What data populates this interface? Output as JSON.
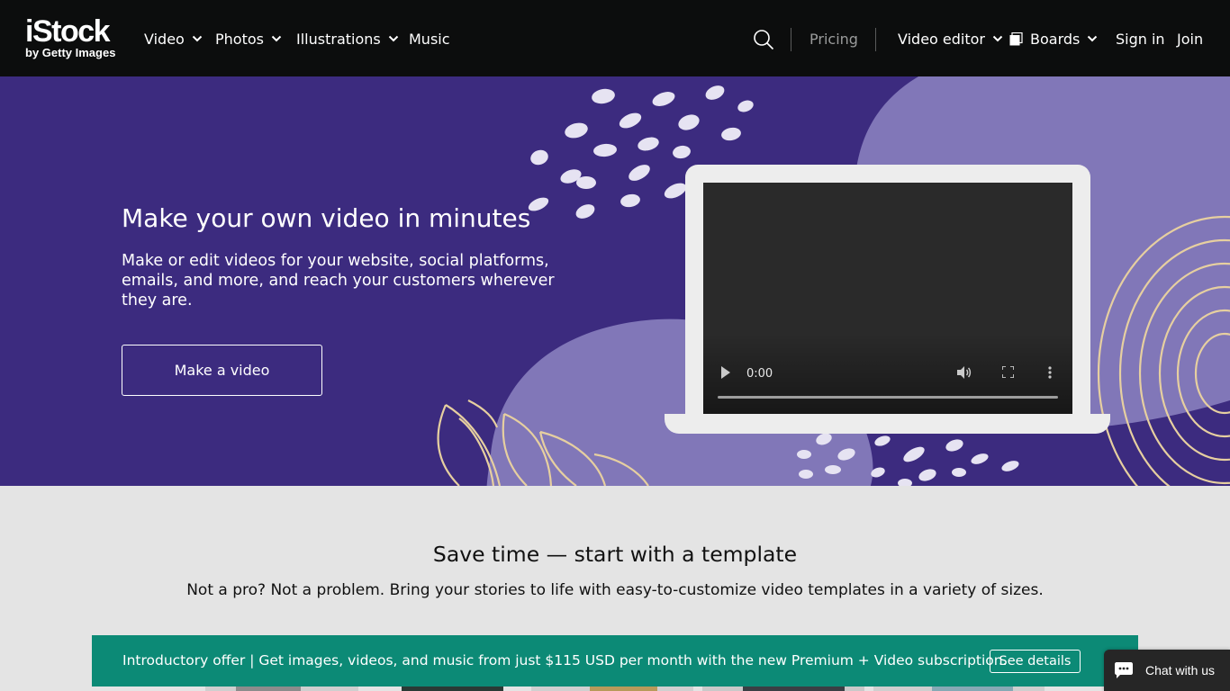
{
  "header": {
    "logo_main": "iStock",
    "logo_sub": "by Getty Images",
    "nav": {
      "video": "Video",
      "photos": "Photos",
      "illustrations": "Illustrations",
      "music": "Music"
    },
    "pricing": "Pricing",
    "video_editor": "Video editor",
    "boards": "Boards",
    "sign_in": "Sign in",
    "join": "Join",
    "icons": [
      "search-icon",
      "chevron-down-icon",
      "boards-icon"
    ]
  },
  "hero": {
    "title": "Make your own video in minutes",
    "subtitle": "Make or edit videos for your website, social platforms, emails, and more, and reach your customers wherever they are.",
    "cta": "Make a video",
    "video": {
      "time": "0:00",
      "progress": 0
    },
    "colors": {
      "background": "#3c2b7f",
      "blob": "#8177b8",
      "line_art": "#e6cfa0"
    }
  },
  "templates": {
    "title": "Save time — start with a template",
    "subtitle": "Not a pro? Not a problem. Bring your stories to life with easy-to-customize video templates in a variety of sizes."
  },
  "promo": {
    "text": "Introductory offer | Get images, videos, and music from just $115 USD per month with the new Premium + Video subscription.",
    "button": "See details",
    "color": "#0c8a76"
  },
  "chat": {
    "label": "Chat with us",
    "icon": "chat-bubble-icon"
  }
}
